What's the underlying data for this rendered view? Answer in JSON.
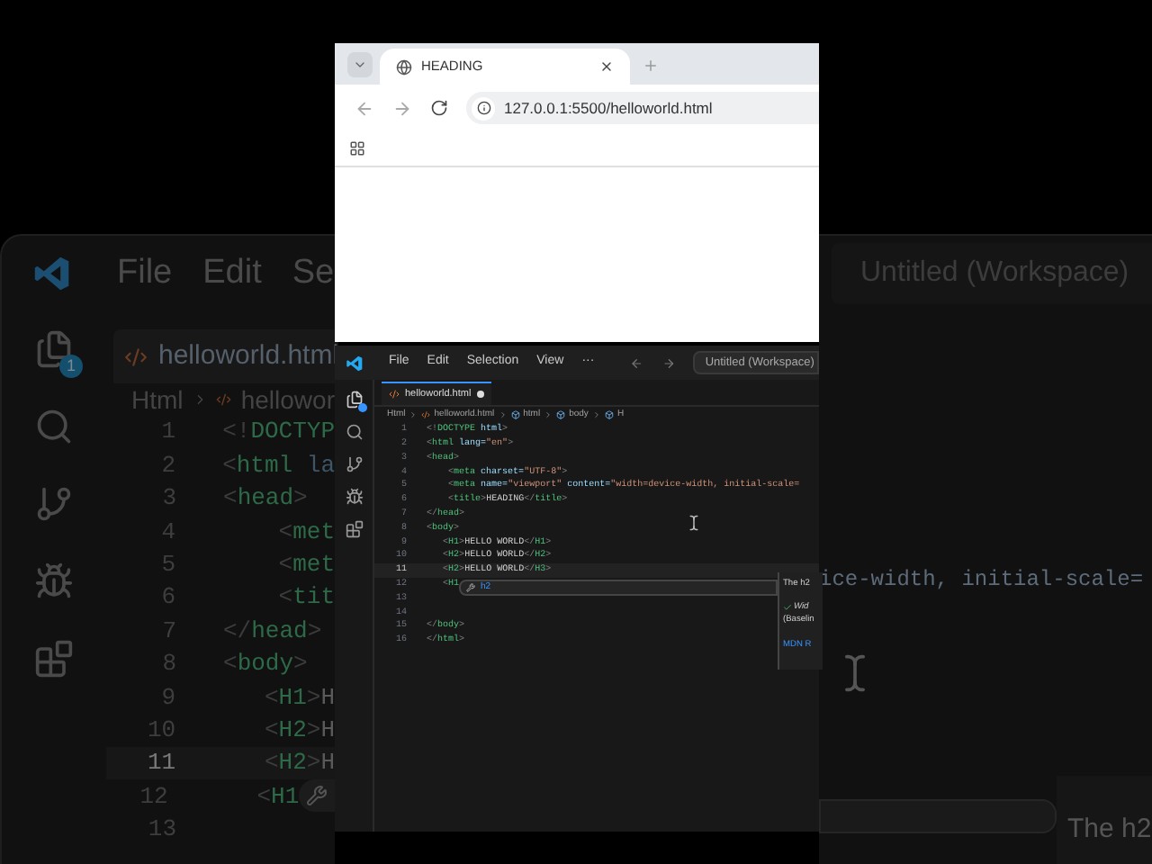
{
  "background_editor": {
    "menu": [
      "File",
      "Edit",
      "Se"
    ],
    "workspace": "Untitled (Workspace)",
    "tab": {
      "label": "helloworld.html"
    },
    "explorer_badge": "1",
    "breadcrumbs": [
      {
        "label": "Html",
        "kind": "folder"
      },
      {
        "label": "hellowor",
        "kind": "file"
      }
    ],
    "lines": [
      {
        "number": "1",
        "code": "<!DOCTYP",
        "current": false
      },
      {
        "number": "2",
        "code": "<html la",
        "current": false
      },
      {
        "number": "3",
        "code": "<head>",
        "current": false
      },
      {
        "number": "4",
        "code": "    <met",
        "current": false
      },
      {
        "number": "5",
        "code": "    <met",
        "current": false
      },
      {
        "number": "6",
        "code": "    <tit",
        "current": false
      },
      {
        "number": "7",
        "code": "</head>",
        "current": false
      },
      {
        "number": "8",
        "code": "<body>",
        "current": false
      },
      {
        "number": "9",
        "code": "   <H1>H",
        "current": false
      },
      {
        "number": "10",
        "code": "   <H2>H",
        "current": false
      },
      {
        "number": "11",
        "code": "   <H2>H",
        "current": true
      },
      {
        "number": "12",
        "code": "   <H1",
        "current": false,
        "suggestion": true
      },
      {
        "number": "13",
        "current": false
      }
    ],
    "right_code": "ice-width, initial-scale=",
    "hover_title": "The h2"
  },
  "browser": {
    "tab": {
      "title": "HEADING"
    },
    "url": "127.0.0.1:5500/helloworld.html"
  },
  "editor": {
    "menu": [
      "File",
      "Edit",
      "Selection",
      "View",
      "···"
    ],
    "workspace": "Untitled (Workspace)",
    "tab": {
      "label": "helloworld.html",
      "modified": true
    },
    "breadcrumbs": [
      {
        "label": "Html",
        "kind": "folder"
      },
      {
        "label": "helloworld.html",
        "kind": "file"
      },
      {
        "label": "html",
        "kind": "element"
      },
      {
        "label": "body",
        "kind": "element"
      },
      {
        "label": "H",
        "kind": "element"
      }
    ],
    "lines": [
      {
        "number": "1",
        "code": "<!DOCTYPE html>",
        "current": false
      },
      {
        "number": "2",
        "code": "<html lang=\"en\">",
        "current": false
      },
      {
        "number": "3",
        "code": "<head>",
        "current": false
      },
      {
        "number": "4",
        "code": "    <meta charset=\"UTF-8\">",
        "current": false
      },
      {
        "number": "5",
        "code": "    <meta name=\"viewport\" content=\"width=device-width, initial-scale=",
        "current": false
      },
      {
        "number": "6",
        "code": "    <title>HEADING</title>",
        "current": false
      },
      {
        "number": "7",
        "code": "</head>",
        "current": false
      },
      {
        "number": "8",
        "code": "<body>",
        "current": false
      },
      {
        "number": "9",
        "code": "   <H1>HELLO WORLD</H1>",
        "current": false
      },
      {
        "number": "10",
        "code": "   <H2>HELLO WORLD</H2>",
        "current": false
      },
      {
        "number": "11",
        "code": "   <H2>HELLO WORLD</H3>",
        "current": true
      },
      {
        "number": "12",
        "code": "   <H1",
        "current": false
      },
      {
        "number": "13",
        "current": false
      },
      {
        "number": "14",
        "current": false
      },
      {
        "number": "15",
        "code": "</body>",
        "current": false
      },
      {
        "number": "16",
        "code": "</html>",
        "current": false
      }
    ],
    "suggestion": {
      "label": "h2"
    },
    "hover": {
      "title": "The h2",
      "status": "Wid",
      "baseline": "(Baselin",
      "link": "MDN R"
    }
  }
}
